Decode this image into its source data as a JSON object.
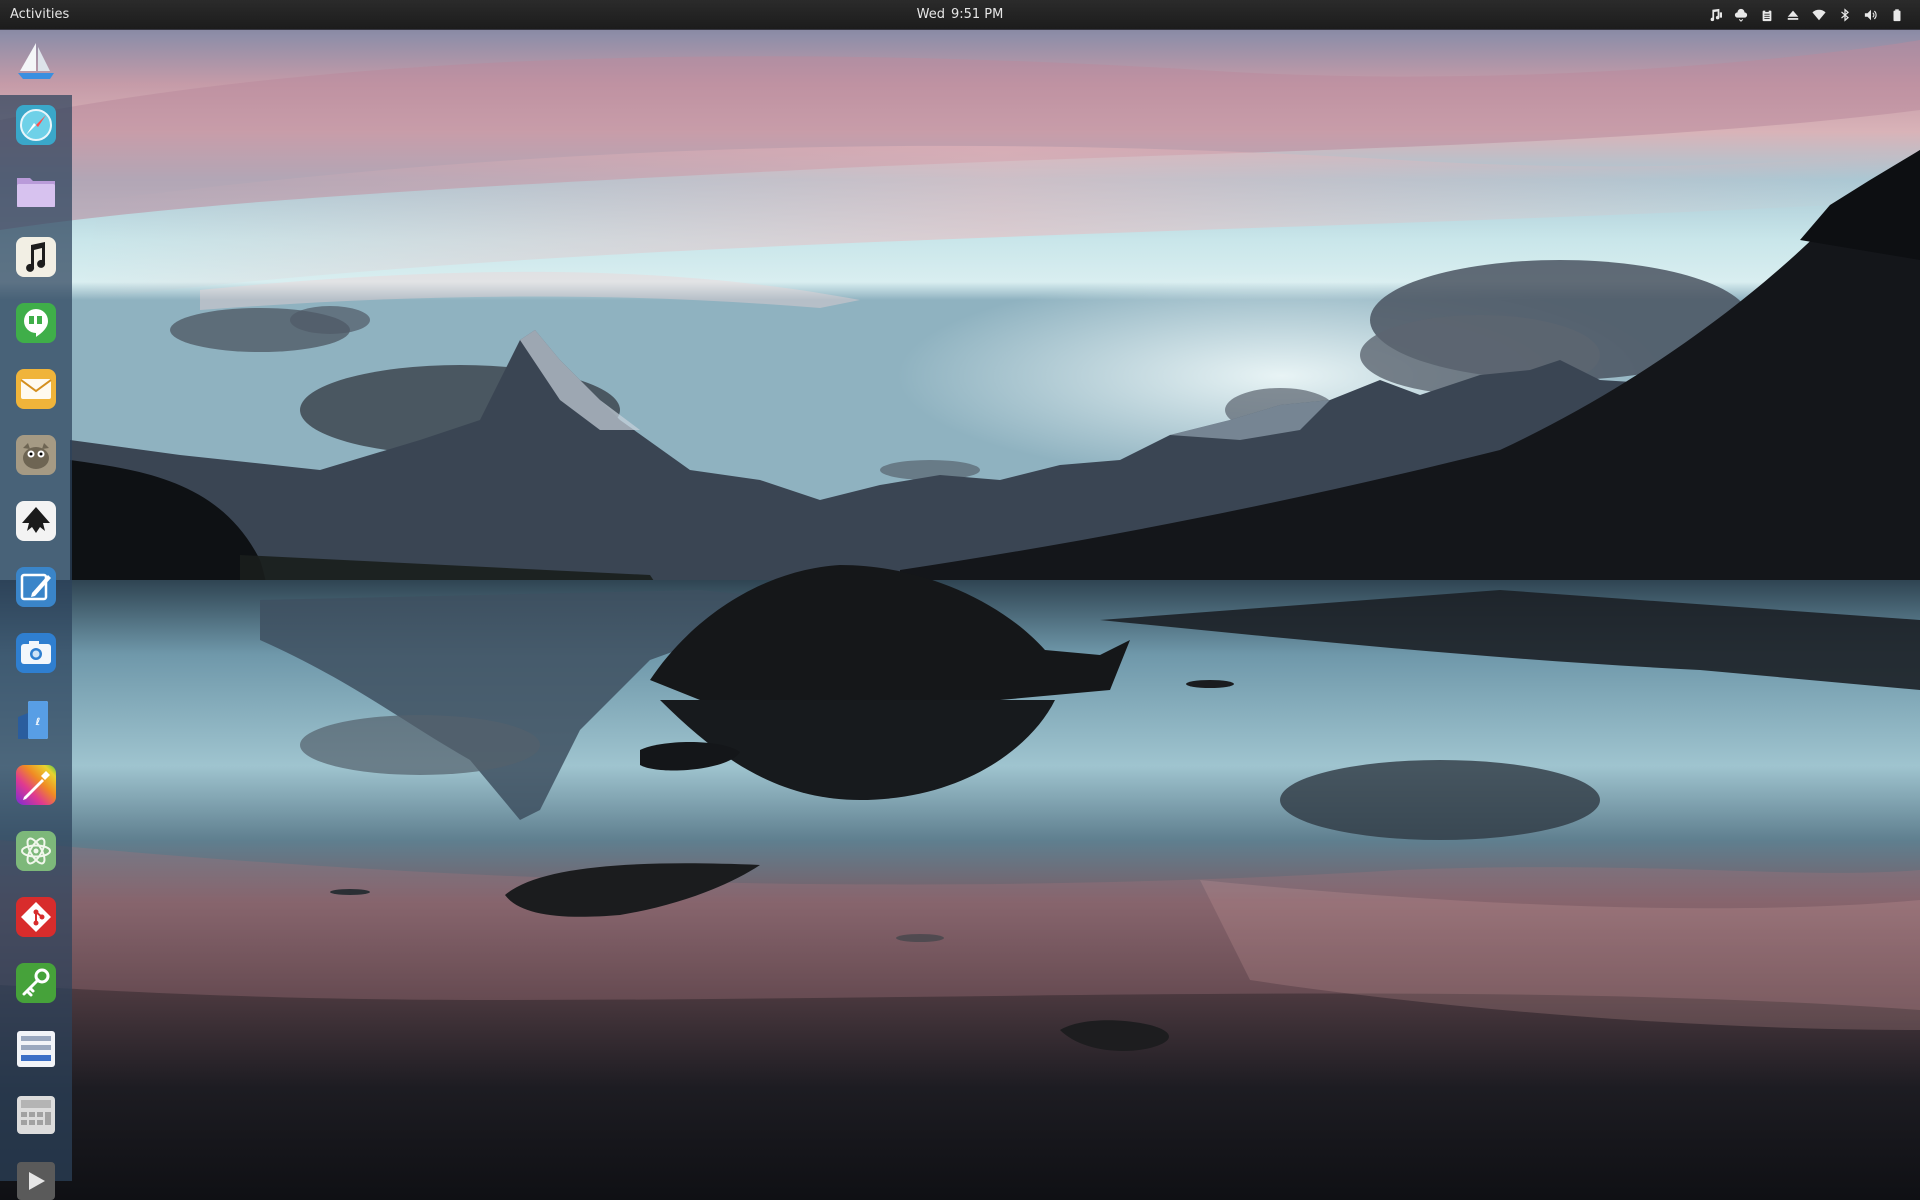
{
  "topbar": {
    "activities_label": "Activities",
    "clock_day": "Wed",
    "clock_time": "9:51 PM",
    "tray_icons": [
      "music-icon",
      "cloud-sync-icon",
      "clipboard-icon",
      "eject-icon",
      "wifi-icon",
      "bluetooth-icon",
      "volume-icon",
      "battery-icon"
    ]
  },
  "dock": {
    "apps": [
      {
        "name": "sailboat-icon"
      },
      {
        "name": "compass-browser-icon"
      },
      {
        "name": "folder-icon"
      },
      {
        "name": "music-note-icon"
      },
      {
        "name": "hangouts-icon"
      },
      {
        "name": "mail-icon"
      },
      {
        "name": "gimp-icon"
      },
      {
        "name": "inkscape-icon"
      },
      {
        "name": "sketch-pen-icon"
      },
      {
        "name": "camera-icon"
      },
      {
        "name": "notes-icon"
      },
      {
        "name": "color-picker-icon"
      },
      {
        "name": "atom-icon"
      },
      {
        "name": "git-icon"
      },
      {
        "name": "key-icon"
      },
      {
        "name": "disks-icon"
      },
      {
        "name": "calculator-icon"
      },
      {
        "name": "video-play-icon"
      }
    ]
  },
  "colors": {
    "topbar_bg": "#222222",
    "dock_bg": "#2d435c",
    "sky_top": "#8a8fa8",
    "sky_pink": "#d4a6b0",
    "sky_cyan": "#bfe4ea",
    "lake": "#5a8a9e"
  }
}
